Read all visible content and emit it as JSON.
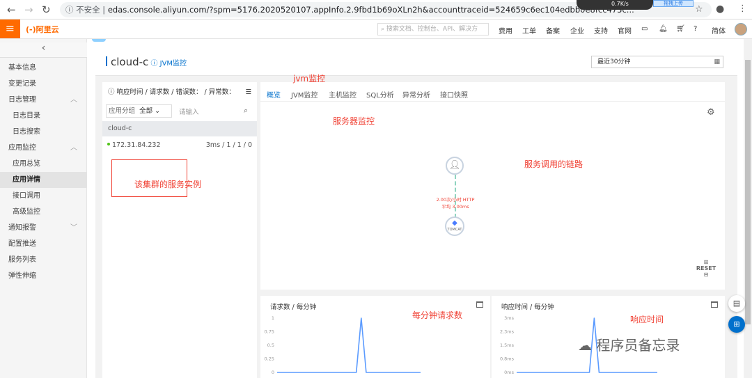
{
  "browser": {
    "url_insecure": "不安全",
    "url": "edas.console.aliyun.com/?spm=5176.2020520107.appInfo.2.9fbd1b69oXLn2h&accounttraceid=524659c6ec104edbb0e8fcc473c...",
    "overlay_speed": "0.7K/s",
    "upload_label": "拖拽上传"
  },
  "header": {
    "logo": "(-)阿里云",
    "search_placeholder": "搜索文档、控制台、API、解决方",
    "links": [
      "费用",
      "工单",
      "备案",
      "企业",
      "支持",
      "官网"
    ],
    "lang": "简体"
  },
  "sidebar": {
    "items": [
      {
        "label": "基本信息",
        "sub": false
      },
      {
        "label": "变更记录",
        "sub": false
      },
      {
        "label": "日志管理",
        "sub": false,
        "chev": "^"
      },
      {
        "label": "日志目录",
        "sub": true
      },
      {
        "label": "日志搜索",
        "sub": true
      },
      {
        "label": "应用监控",
        "sub": false,
        "chev": "^"
      },
      {
        "label": "应用总览",
        "sub": true
      },
      {
        "label": "应用详情",
        "sub": true,
        "active": true
      },
      {
        "label": "接口调用",
        "sub": true
      },
      {
        "label": "高级监控",
        "sub": true
      },
      {
        "label": "通知报警",
        "sub": false,
        "chev": "v"
      },
      {
        "label": "配置推送",
        "sub": false
      },
      {
        "label": "服务列表",
        "sub": false
      },
      {
        "label": "弹性伸缩",
        "sub": false
      }
    ]
  },
  "page": {
    "title": "cloud-c",
    "jvm_link": "JVM监控",
    "time_range": "最近30分钟"
  },
  "instances": {
    "header": "响应时间 / 请求数 / 错误数： / 异常数：",
    "group_label": "应用分组",
    "group_value": "全部",
    "search_placeholder": "请输入",
    "cluster": "cloud-c",
    "rows": [
      {
        "ip": "172.31.84.232",
        "metrics": "3ms / 1 / 1 / 0"
      }
    ]
  },
  "tabs": [
    "概览",
    "JVM监控",
    "主机监控",
    "SQL分析",
    "异常分析",
    "接口快照"
  ],
  "topology": {
    "edge_label_1": "2.00次/小时 HTTP",
    "edge_label_2": "平均 3.00ms",
    "node_label": "TOMCAT",
    "reset": "RESET"
  },
  "annotations": {
    "jvm": "jvm监控",
    "server": "服务器监控",
    "chain": "服务调用的链路",
    "instance": "该集群的服务实例",
    "per_min": "每分钟请求数",
    "resp": "响应时间"
  },
  "watermark": "程序员备忘录",
  "colors": {
    "accent": "#0070cc",
    "brand": "#ff6a00",
    "annotation": "#f04134",
    "line": "#5b9bff"
  },
  "chart_data": [
    {
      "type": "line",
      "title": "请求数 / 每分钟",
      "yticks": [
        "1",
        "0.75",
        "0.5",
        "0.25",
        "0"
      ],
      "ylim": [
        0,
        1
      ],
      "x": [
        1,
        2,
        3,
        4,
        5,
        6,
        7,
        8,
        9,
        10,
        11,
        12,
        13,
        14,
        15,
        16,
        17,
        18,
        19,
        20,
        21,
        22,
        23,
        24,
        25,
        26,
        27,
        28,
        29,
        30
      ],
      "values": [
        0,
        0,
        0,
        0,
        0,
        0,
        0,
        0,
        0,
        0,
        0,
        0,
        0,
        0,
        0,
        0,
        0,
        1,
        0,
        0,
        0,
        0,
        0,
        0,
        0,
        0,
        0,
        0,
        0,
        0
      ]
    },
    {
      "type": "line",
      "title": "响应时间 / 每分钟",
      "yticks": [
        "3ms",
        "2.3ms",
        "1.5ms",
        "0.8ms",
        "0ms"
      ],
      "ylim": [
        0,
        3
      ],
      "x": [
        1,
        2,
        3,
        4,
        5,
        6,
        7,
        8,
        9,
        10,
        11,
        12,
        13,
        14,
        15,
        16,
        17,
        18,
        19,
        20,
        21,
        22,
        23,
        24,
        25,
        26,
        27,
        28,
        29,
        30
      ],
      "values": [
        0,
        0,
        0,
        0,
        0,
        0,
        0,
        0,
        0,
        0,
        0,
        0,
        0,
        0,
        0,
        0,
        3,
        0,
        0,
        0,
        0,
        0,
        0,
        0,
        0,
        0,
        0,
        0,
        0,
        0
      ]
    }
  ]
}
